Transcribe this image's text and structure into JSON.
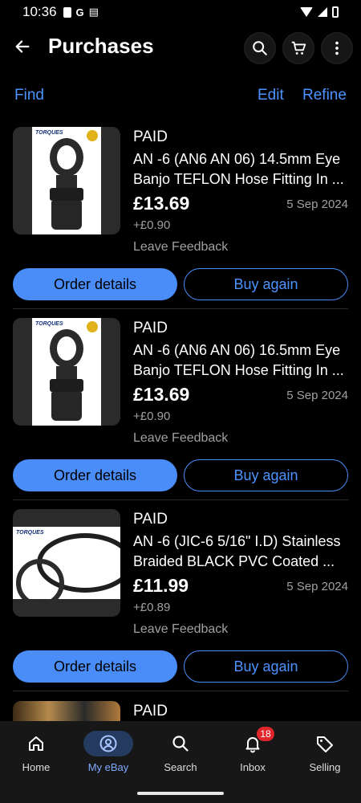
{
  "status_bar": {
    "time": "10:36",
    "icons": [
      "battery-saver-icon",
      "google-icon",
      "news-icon"
    ],
    "right_icons": [
      "wifi-icon",
      "signal-icon",
      "battery-icon"
    ]
  },
  "app_bar": {
    "title": "Purchases",
    "actions": [
      "search-icon",
      "cart-icon",
      "more-icon"
    ]
  },
  "actions": {
    "find": "Find",
    "edit": "Edit",
    "refine": "Refine"
  },
  "items": [
    {
      "status": "PAID",
      "title_line1": "AN -6 (AN6 AN 06) 14.5mm Eye",
      "title_line2": "Banjo TEFLON Hose Fitting In ...",
      "price": "£13.69",
      "postage": "+£0.90",
      "date": "5 Sep 2024",
      "feedback": "Leave Feedback",
      "order_btn": "Order details",
      "buy_btn": "Buy again",
      "thumb_logo": "TORQUES"
    },
    {
      "status": "PAID",
      "title_line1": "AN -6 (AN6 AN 06) 16.5mm Eye",
      "title_line2": "Banjo TEFLON Hose Fitting In ...",
      "price": "£13.69",
      "postage": "+£0.90",
      "date": "5 Sep 2024",
      "feedback": "Leave Feedback",
      "order_btn": "Order details",
      "buy_btn": "Buy again",
      "thumb_logo": "TORQUES"
    },
    {
      "status": "PAID",
      "title_line1": "AN -6 (JIC-6 5/16\" I.D) Stainless",
      "title_line2": "Braided BLACK PVC Coated ...",
      "price": "£11.99",
      "postage": "+£0.89",
      "date": "5 Sep 2024",
      "feedback": "Leave Feedback",
      "order_btn": "Order details",
      "buy_btn": "Buy again",
      "thumb_logo": "TORQUES"
    }
  ],
  "peek_item": {
    "status": "PAID"
  },
  "bottom_nav": [
    {
      "label": "Home",
      "icon": "home-icon",
      "active": false
    },
    {
      "label": "My eBay",
      "icon": "account-icon",
      "active": true
    },
    {
      "label": "Search",
      "icon": "search-icon",
      "active": false
    },
    {
      "label": "Inbox",
      "icon": "bell-icon",
      "active": false,
      "badge": "18"
    },
    {
      "label": "Selling",
      "icon": "tag-icon",
      "active": false
    }
  ],
  "colors": {
    "accent": "#4a8df8",
    "background": "#000000",
    "nav_background": "#171717",
    "badge": "#e0252b"
  }
}
